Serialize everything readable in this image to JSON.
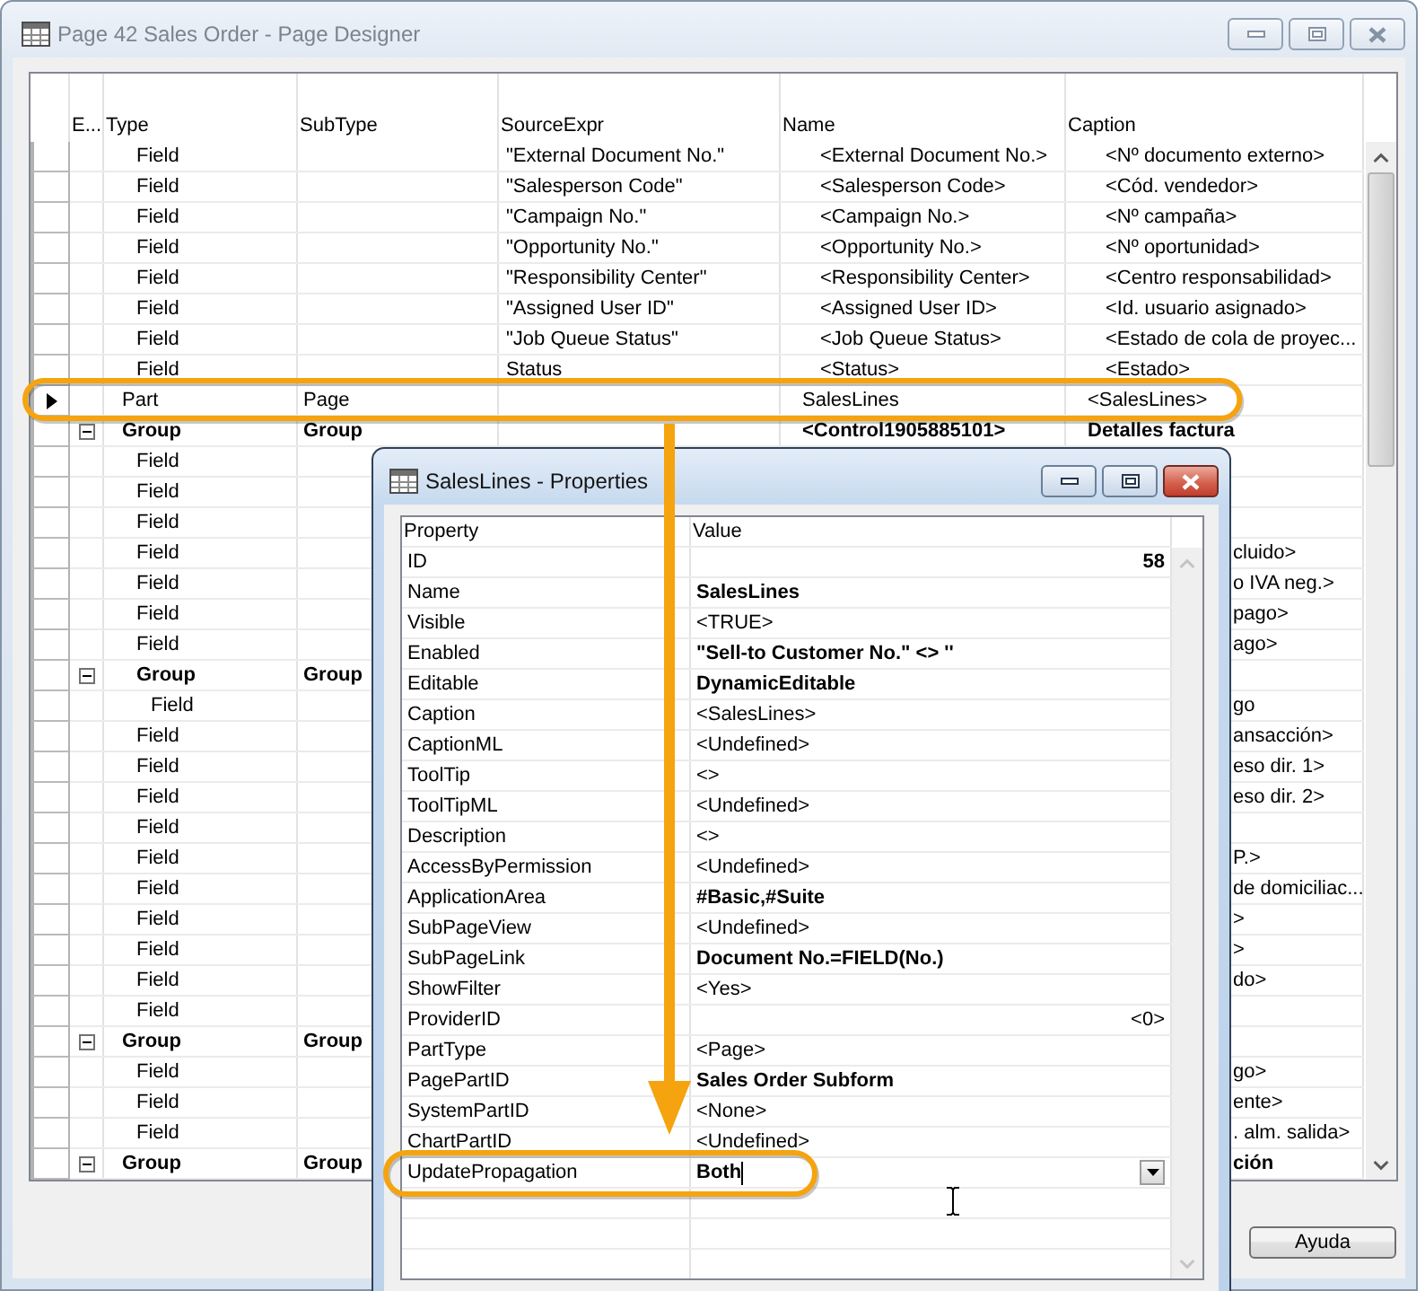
{
  "designer_window": {
    "title": "Page 42 Sales Order - Page Designer",
    "active": false,
    "table": {
      "columns": [
        "E...",
        "Type",
        "SubType",
        "SourceExpr",
        "Name",
        "Caption"
      ],
      "rows": [
        {
          "children": [
            {
              "kind": "field",
              "type": "Field",
              "source_expr": "\"External Document No.\"",
              "name": "<External Document No.>",
              "caption": "<Nº documento externo>",
              "selected": false,
              "highlighted": false
            },
            {
              "kind": "field",
              "type": "Field",
              "source_expr": "\"Salesperson Code\"",
              "name": "<Salesperson Code>",
              "caption": "<Cód. vendedor>",
              "selected": false,
              "highlighted": false
            },
            {
              "kind": "field",
              "type": "Field",
              "source_expr": "\"Campaign No.\"",
              "name": "<Campaign No.>",
              "caption": "<Nº campaña>",
              "selected": false,
              "highlighted": false
            },
            {
              "kind": "field",
              "type": "Field",
              "source_expr": "\"Opportunity No.\"",
              "name": "<Opportunity No.>",
              "caption": "<Nº oportunidad>",
              "selected": false,
              "highlighted": false
            },
            {
              "kind": "field",
              "type": "Field",
              "source_expr": "\"Responsibility Center\"",
              "name": "<Responsibility Center>",
              "caption": "<Centro responsabilidad>",
              "selected": false,
              "highlighted": false
            },
            {
              "kind": "field",
              "type": "Field",
              "source_expr": "\"Assigned User ID\"",
              "name": "<Assigned User ID>",
              "caption": "<Id. usuario asignado>",
              "selected": false,
              "highlighted": false
            },
            {
              "kind": "field",
              "type": "Field",
              "source_expr": "\"Job Queue Status\"",
              "name": "<Job Queue Status>",
              "caption": "<Estado de cola de proyec...",
              "selected": false,
              "highlighted": false
            },
            {
              "kind": "field",
              "type": "Field",
              "source_expr": "Status",
              "name": "<Status>",
              "caption": "<Estado>",
              "selected": false,
              "highlighted": false
            }
          ]
        },
        {
          "kind": "part",
          "type": "Part",
          "subtype": "Page",
          "name": "SalesLines",
          "caption": "<SalesLines>",
          "selected": true,
          "highlighted": true
        },
        {
          "kind": "group",
          "type": "Group",
          "subtype": "Group",
          "name": "<Control1905885101>",
          "caption": "Detalles factura",
          "expanded": true,
          "selected": false,
          "highlighted": false,
          "children": [
            {
              "kind": "field",
              "type": "Field",
              "selected": false,
              "highlighted": false
            },
            {
              "kind": "field",
              "type": "Field",
              "selected": false,
              "highlighted": false
            },
            {
              "kind": "field",
              "type": "Field",
              "selected": false,
              "highlighted": false
            },
            {
              "kind": "field",
              "type": "Field",
              "caption": "cluido>",
              "selected": false,
              "highlighted": false
            },
            {
              "kind": "field",
              "type": "Field",
              "caption": "o IVA neg.>",
              "selected": false,
              "highlighted": false
            },
            {
              "kind": "field",
              "type": "Field",
              "caption": "pago>",
              "selected": false,
              "highlighted": false
            },
            {
              "kind": "field",
              "type": "Field",
              "caption": "ago>",
              "selected": false,
              "highlighted": false
            },
            {
              "kind": "group",
              "type": "Group",
              "subtype": "Group",
              "expanded": true,
              "selected": false,
              "highlighted": false,
              "children": [
                {
                  "kind": "field",
                  "type": "Field",
                  "caption": "go",
                  "selected": false,
                  "highlighted": false
                }
              ]
            },
            {
              "kind": "field",
              "type": "Field",
              "caption": "ansacción>",
              "selected": false,
              "highlighted": false
            },
            {
              "kind": "field",
              "type": "Field",
              "caption": "eso dir. 1>",
              "selected": false,
              "highlighted": false
            },
            {
              "kind": "field",
              "type": "Field",
              "caption": "eso dir. 2>",
              "selected": false,
              "highlighted": false
            },
            {
              "kind": "field",
              "type": "Field",
              "selected": false,
              "highlighted": false
            },
            {
              "kind": "field",
              "type": "Field",
              "caption": "P.>",
              "selected": false,
              "highlighted": false
            },
            {
              "kind": "field",
              "type": "Field",
              "caption": "de domiciliac...",
              "selected": false,
              "highlighted": false
            },
            {
              "kind": "field",
              "type": "Field",
              "caption": ">",
              "selected": false,
              "highlighted": false
            },
            {
              "kind": "field",
              "type": "Field",
              "caption": ">",
              "selected": false,
              "highlighted": false
            },
            {
              "kind": "field",
              "type": "Field",
              "caption": "do>",
              "selected": false,
              "highlighted": false
            },
            {
              "kind": "field",
              "type": "Field",
              "selected": false,
              "highlighted": false
            }
          ]
        },
        {
          "kind": "group",
          "type": "Group",
          "subtype": "Group",
          "expanded": true,
          "selected": false,
          "highlighted": false,
          "children": [
            {
              "kind": "field",
              "type": "Field",
              "caption": "go>",
              "selected": false,
              "highlighted": false
            },
            {
              "kind": "field",
              "type": "Field",
              "caption": "ente>",
              "selected": false,
              "highlighted": false
            },
            {
              "kind": "field",
              "type": "Field",
              "caption": ". alm. salida>",
              "selected": false,
              "highlighted": false
            }
          ]
        },
        {
          "kind": "group",
          "type": "Group",
          "subtype": "Group",
          "caption": "ción",
          "expanded": true,
          "selected": false,
          "highlighted": false
        }
      ]
    },
    "buttons": [
      "Ayuda"
    ]
  },
  "properties_window": {
    "title": "SalesLines - Properties",
    "active": true,
    "table": {
      "columns": [
        "Property",
        "Value"
      ],
      "rows": [
        {
          "property": "ID",
          "value": "58",
          "kind": "number",
          "modified": true,
          "selected": false,
          "highlighted": false
        },
        {
          "property": "Name",
          "value": "SalesLines",
          "kind": "text",
          "modified": true,
          "selected": false,
          "highlighted": false
        },
        {
          "property": "Visible",
          "value": "<TRUE>",
          "kind": "text",
          "modified": false,
          "selected": false,
          "highlighted": false
        },
        {
          "property": "Enabled",
          "value": "\"Sell-to Customer No.\" <> ''",
          "kind": "text",
          "modified": true,
          "selected": false,
          "highlighted": false
        },
        {
          "property": "Editable",
          "value": "DynamicEditable",
          "kind": "text",
          "modified": true,
          "selected": false,
          "highlighted": false
        },
        {
          "property": "Caption",
          "value": "<SalesLines>",
          "kind": "text",
          "modified": false,
          "selected": false,
          "highlighted": false
        },
        {
          "property": "CaptionML",
          "value": "<Undefined>",
          "kind": "text",
          "modified": false,
          "selected": false,
          "highlighted": false
        },
        {
          "property": "ToolTip",
          "value": "<>",
          "kind": "text",
          "modified": false,
          "selected": false,
          "highlighted": false
        },
        {
          "property": "ToolTipML",
          "value": "<Undefined>",
          "kind": "text",
          "modified": false,
          "selected": false,
          "highlighted": false
        },
        {
          "property": "Description",
          "value": "<>",
          "kind": "text",
          "modified": false,
          "selected": false,
          "highlighted": false
        },
        {
          "property": "AccessByPermission",
          "value": "<Undefined>",
          "kind": "text",
          "modified": false,
          "selected": false,
          "highlighted": false
        },
        {
          "property": "ApplicationArea",
          "value": "#Basic,#Suite",
          "kind": "text",
          "modified": true,
          "selected": false,
          "highlighted": false
        },
        {
          "property": "SubPageView",
          "value": "<Undefined>",
          "kind": "text",
          "modified": false,
          "selected": false,
          "highlighted": false
        },
        {
          "property": "SubPageLink",
          "value": "Document No.=FIELD(No.)",
          "kind": "text",
          "modified": true,
          "selected": false,
          "highlighted": false
        },
        {
          "property": "ShowFilter",
          "value": "<Yes>",
          "kind": "text",
          "modified": false,
          "selected": false,
          "highlighted": false
        },
        {
          "property": "ProviderID",
          "value": "<0>",
          "kind": "number",
          "modified": false,
          "selected": false,
          "highlighted": false
        },
        {
          "property": "PartType",
          "value": "<Page>",
          "kind": "text",
          "modified": false,
          "selected": false,
          "highlighted": false
        },
        {
          "property": "PagePartID",
          "value": "Sales Order Subform",
          "kind": "text",
          "modified": true,
          "selected": false,
          "highlighted": false
        },
        {
          "property": "SystemPartID",
          "value": "<None>",
          "kind": "text",
          "modified": false,
          "selected": false,
          "highlighted": false
        },
        {
          "property": "ChartPartID",
          "value": "<Undefined>",
          "kind": "text",
          "modified": false,
          "selected": false,
          "highlighted": false
        },
        {
          "property": "UpdatePropagation",
          "value": "Both",
          "kind": "text",
          "modified": true,
          "selected": true,
          "highlighted": true
        }
      ]
    }
  }
}
